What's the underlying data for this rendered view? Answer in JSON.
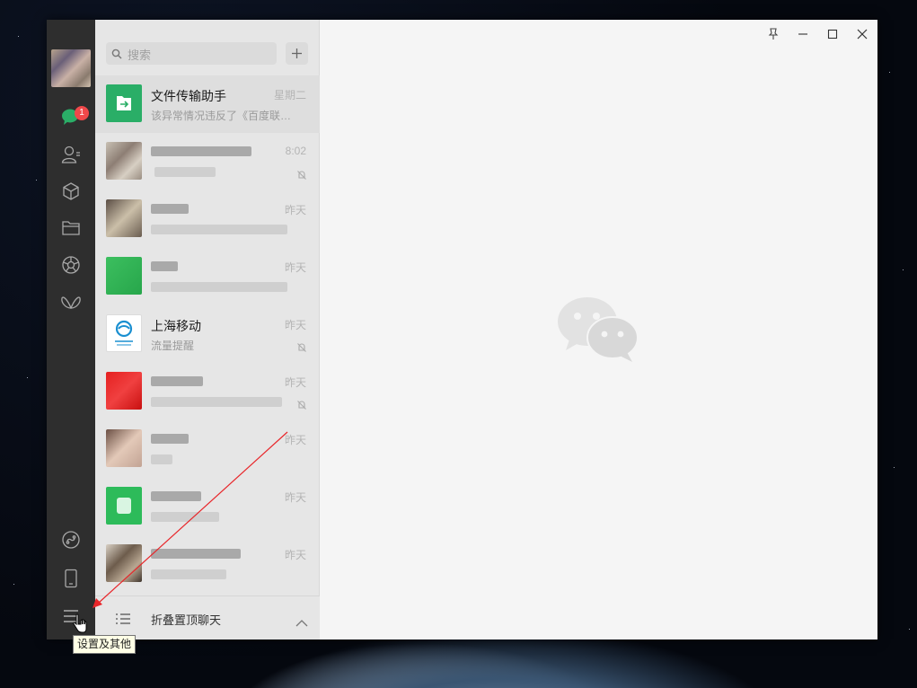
{
  "window": {
    "controls": {
      "pin": "pin-icon",
      "minimize": "minimize-icon",
      "maximize": "maximize-icon",
      "close": "close-icon"
    }
  },
  "sidebar": {
    "badge_count": "1",
    "top_items": [
      "chat-icon",
      "contacts-icon",
      "favorites-icon",
      "files-icon",
      "moments-icon",
      "mini-program-icon"
    ],
    "bottom_items": [
      "mini-program-panel-icon",
      "phone-icon",
      "menu-icon"
    ]
  },
  "search": {
    "placeholder": "搜索"
  },
  "add_button": "+",
  "conversations": [
    {
      "name": "文件传输助手",
      "preview": "该异常情况违反了《百度联…",
      "time": "星期二",
      "muted": false
    },
    {
      "name": "",
      "preview": "",
      "time": "8:02",
      "muted": true
    },
    {
      "name": "",
      "preview": "",
      "time": "昨天",
      "muted": false
    },
    {
      "name": "",
      "preview": "",
      "time": "昨天",
      "muted": false
    },
    {
      "name": "上海移动",
      "preview": "流量提醒",
      "time": "昨天",
      "muted": true
    },
    {
      "name": "",
      "preview": "",
      "time": "昨天",
      "muted": true
    },
    {
      "name": "",
      "preview": "",
      "time": "昨天",
      "muted": false
    },
    {
      "name": "",
      "preview": "",
      "time": "昨天",
      "muted": false
    },
    {
      "name": "",
      "preview": "",
      "time": "昨天",
      "muted": false
    }
  ],
  "fold_bar": {
    "label": "折叠置顶聊天"
  },
  "tooltip": {
    "text": "设置及其他"
  },
  "colors": {
    "sidebar_bg": "#2e2e2e",
    "list_bg": "#e6e6e6",
    "main_bg": "#f5f5f5",
    "badge": "#f0484a",
    "wechat_green": "#2aae67",
    "annotation_red": "#e8262a"
  }
}
